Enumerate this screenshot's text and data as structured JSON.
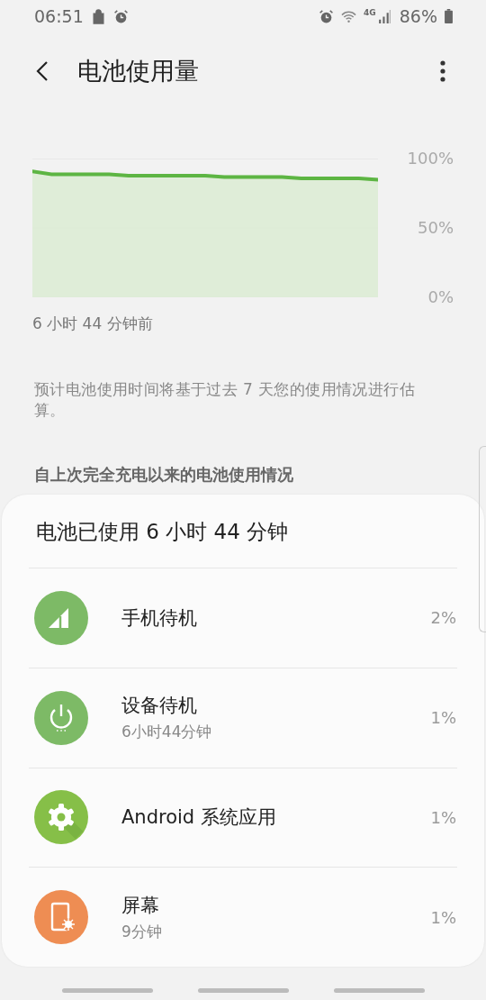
{
  "status_bar": {
    "time": "06:51",
    "network": "4G",
    "battery": "86%"
  },
  "header": {
    "title": "电池使用量"
  },
  "chart": {
    "chart_data": {
      "type": "area",
      "ylim": [
        0,
        100
      ],
      "yticks": [
        {
          "value": 0,
          "label": "0%"
        },
        {
          "value": 50,
          "label": "50%"
        },
        {
          "value": 100,
          "label": "100%"
        }
      ],
      "values": [
        92,
        90,
        90,
        90,
        90,
        89,
        89,
        89,
        89,
        89,
        88,
        88,
        88,
        88,
        87,
        87,
        87,
        87,
        86
      ]
    },
    "start_label": "6 小时 44 分钟前"
  },
  "note": "预计电池使用时间将基于过去 7 天您的使用情况进行估算。",
  "section_title": "自上次完全充电以来的电池使用情况",
  "card": {
    "title": "电池已使用 6 小时 44 分钟",
    "items": [
      {
        "kind": "signal",
        "color": "#7dba66",
        "name": "手机待机",
        "percent": "2%"
      },
      {
        "kind": "power",
        "color": "#7dba66",
        "name": "设备待机",
        "detail": "6小时44分钟",
        "percent": "1%"
      },
      {
        "kind": "gear",
        "color": "#86bf48",
        "name": "Android 系统应用",
        "percent": "1%"
      },
      {
        "kind": "screen",
        "color": "#ee8d53",
        "name": "屏幕",
        "detail": "9分钟",
        "percent": "1%"
      }
    ]
  }
}
